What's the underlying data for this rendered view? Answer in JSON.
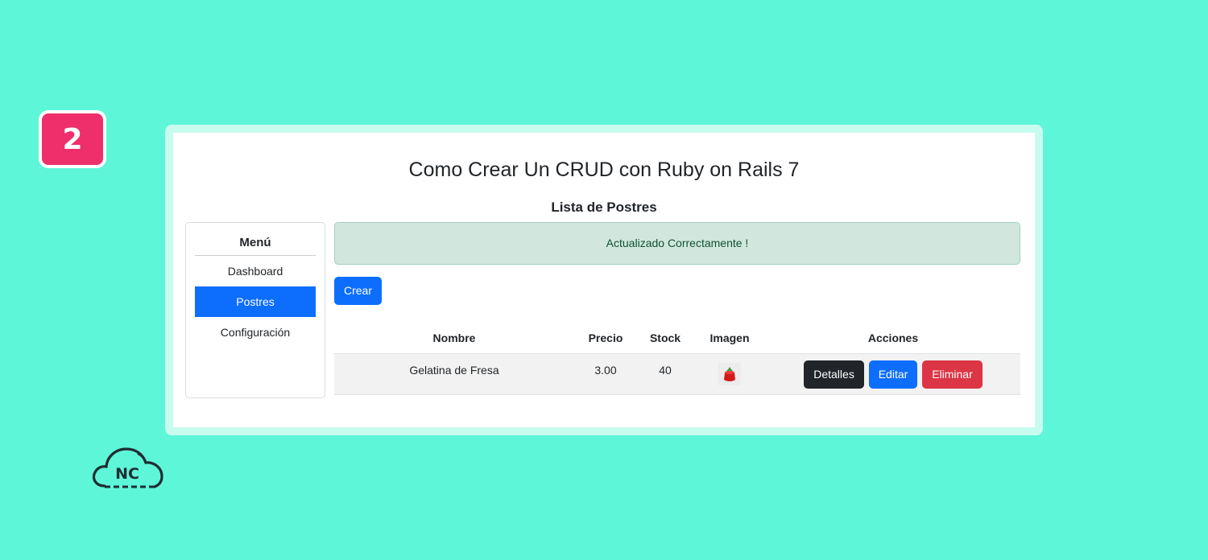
{
  "badge": {
    "step": "2"
  },
  "app": {
    "title": "Como Crear Un CRUD con Ruby on Rails 7",
    "list_title": "Lista de Postres"
  },
  "sidebar": {
    "title": "Menú",
    "items": [
      {
        "label": "Dashboard",
        "active": false
      },
      {
        "label": "Postres",
        "active": true
      },
      {
        "label": "Configuración",
        "active": false
      }
    ]
  },
  "alert": {
    "message": "Actualizado Correctamente !"
  },
  "create_button": {
    "label": "Crear"
  },
  "table": {
    "headers": [
      "Nombre",
      "Precio",
      "Stock",
      "Imagen",
      "Acciones"
    ],
    "rows": [
      {
        "nombre": "Gelatina de Fresa",
        "precio": "3.00",
        "stock": "40",
        "imagen_icon": "strawberry-jelly-thumbnail",
        "actions": {
          "details": "Detalles",
          "edit": "Editar",
          "delete": "Eliminar"
        }
      }
    ]
  },
  "logo": {
    "text": "NC",
    "icon": "cloud-logo-icon"
  },
  "colors": {
    "background": "#5ef6d8",
    "badge": "#ee2f6b",
    "primary": "#0d6efd",
    "dark": "#212529",
    "danger": "#dc3545",
    "alert_success": "#d1e7dd"
  }
}
